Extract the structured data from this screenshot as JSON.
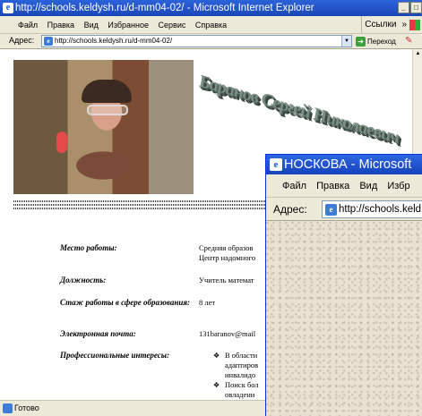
{
  "back_window": {
    "title": "http://schools.keldysh.ru/d-mm04-02/ - Microsoft Internet Explorer",
    "menu": [
      "Файл",
      "Правка",
      "Вид",
      "Избранное",
      "Сервис",
      "Справка"
    ],
    "links_label": "Ссылки",
    "links_chevron": "»",
    "address_label": "Адрес:",
    "address_value": "http://schools.keldysh.ru/d-mm04-02/",
    "go_label": "Переход",
    "status_text": "Готово",
    "logo_text": "Баранов Сергей Николаевич",
    "rows": [
      {
        "label": "Место работы:",
        "value_lines": [
          "Средняя образов",
          "Центр надомного"
        ]
      },
      {
        "label": "Должность:",
        "value_lines": [
          "Учитель математ"
        ]
      },
      {
        "label": "Стаж работы в сфере образования:",
        "value_lines": [
          "8 лет"
        ]
      },
      {
        "label": "Электронная почта:",
        "value_lines": [
          "131baranov@mail"
        ]
      },
      {
        "label": "Профессиональные интересы:",
        "bullets": [
          [
            "В области",
            "адаптиров",
            "инвалидо"
          ],
          [
            "Поиск бол",
            "овладени"
          ]
        ]
      }
    ]
  },
  "front_window": {
    "title": "НОСКОВА - Microsoft",
    "menu": [
      "Файл",
      "Правка",
      "Вид",
      "Избр"
    ],
    "address_label": "Адрес:",
    "address_value": "http://schools.keld"
  }
}
